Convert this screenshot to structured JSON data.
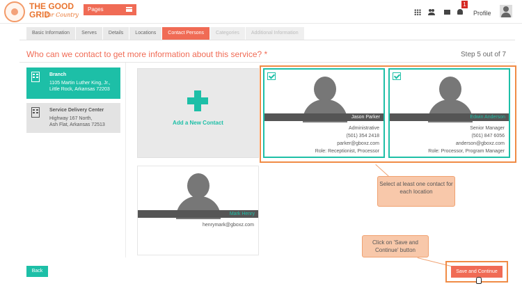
{
  "header": {
    "logo_title": "THE GOOD GRID",
    "logo_subtitle": "for Country",
    "pages_label": "Pages",
    "notification_count": "1",
    "profile_label": "Profile"
  },
  "tabs": [
    {
      "label": "Basic Information",
      "state": "normal"
    },
    {
      "label": "Serves",
      "state": "normal"
    },
    {
      "label": "Details",
      "state": "normal"
    },
    {
      "label": "Locations",
      "state": "normal"
    },
    {
      "label": "Contact Persons",
      "state": "active"
    },
    {
      "label": "Categories",
      "state": "disabled"
    },
    {
      "label": "Additional Information",
      "state": "disabled"
    }
  ],
  "question": "Who can we contact to get more information about this service? *",
  "step_label": "Step 5 out of 7",
  "locations": [
    {
      "title": "Branch",
      "line1": "1105 Martin Luther King, Jr.,",
      "line2": "Little Rock, Arkansas 72203"
    },
    {
      "title": "Service Delivery Center",
      "line1": "Highway 167 North,",
      "line2": "Ash Flat, Arkansas 72513"
    }
  ],
  "add_contact_label": "Add a New Contact",
  "contacts": [
    {
      "name": "Jason Parker",
      "title": "Administrative",
      "phone": "(501) 354 2418",
      "email": "parker@gboxz.com",
      "role": "Role:  Receptionist, Processor"
    },
    {
      "name": "Edwin Anderson",
      "title": "Senior Manager",
      "phone": "(501) 847 6056",
      "email": "anderson@gboxz.com",
      "role": "Role:  Processor, Program Manager"
    },
    {
      "name": "Mark Henry",
      "email": "henrymark@gboxz.com"
    }
  ],
  "callouts": {
    "select": "Select at least one contact for each location",
    "save": "Click on 'Save and Continue' button"
  },
  "buttons": {
    "back": "Back",
    "save": "Save and Continue"
  },
  "colors": {
    "accent": "#f06b55",
    "teal": "#1dbfa7",
    "highlight": "#f08b45"
  }
}
